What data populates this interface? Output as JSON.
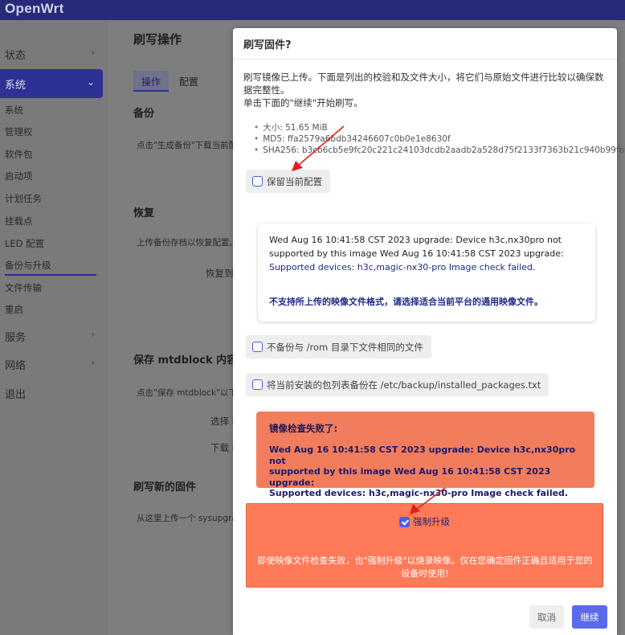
{
  "brand": "OpenWrt",
  "colors": {
    "topbar": "#262a78",
    "accent": "#2d3194",
    "danger_card": "#f27d5c",
    "force_card": "#ff7a59",
    "primary_button": "#5a6ae8",
    "annotation_arrow": "#e02020"
  },
  "sidebar": {
    "items": [
      {
        "label": "状态",
        "icon": "chevron-right-icon"
      },
      {
        "label": "系统",
        "icon": "chevron-down-icon",
        "active": true
      },
      {
        "label": "服务",
        "icon": "chevron-right-icon"
      },
      {
        "label": "网络",
        "icon": "chevron-right-icon"
      },
      {
        "label": "退出"
      }
    ],
    "submenu": [
      "系统",
      "管理权",
      "软件包",
      "启动项",
      "计划任务",
      "挂载点",
      "LED 配置",
      "备份与升级",
      "文件传输",
      "重启"
    ]
  },
  "background": {
    "title": "刷写操作",
    "tabs": [
      "操作",
      "配置"
    ],
    "sections": {
      "backup": "备份",
      "backup_text": "点击\"生成备份\"下载当前配",
      "restore": "恢复",
      "restore_text": "上传备份存档以恢复配置。",
      "restore_to": "恢复到",
      "mtd": "保存 mtdblock 内容",
      "mtd_text": "点击\"保存 mtdblock\"以下",
      "select": "选择 r",
      "download": "下载 r",
      "flash": "刷写新的固件",
      "flash_text": "从这里上传一个 sysupgra"
    }
  },
  "modal": {
    "title": "刷写固件?",
    "intro_line1": "刷写镜像已上传。下面是列出的校验和及文件大小，将它们与原始文件进行比较以确保数据完整性。",
    "intro_line2": "单击下面的\"继续\"开始刷写。",
    "info": {
      "size": "大小: 51.65 MiB",
      "md5": "MD5: ffa2579a6bdb34246607c0b0e1e8630f",
      "sha256": "SHA256: b3cb6cb5e9fc20c221c24103dcdb2aadb2a528d75f2133f7363b21c940b99fbf"
    },
    "keep_config": {
      "label": "保留当前配置",
      "checked": false
    },
    "log": {
      "line1": "Wed Aug 16 10:41:58 CST 2023 upgrade: Device h3c,nx30pro not",
      "line2": "supported by this image Wed Aug 16 10:41:58 CST 2023 upgrade:",
      "line3": "Supported devices: h3c,magic-nx30-pro Image check failed.",
      "error": "不支持所上传的映像文件格式，请选择适合当前平台的通用映像文件。"
    },
    "skip_rom_backup": {
      "label": "不备份与 /rom 目录下文件相同的文件",
      "checked": false
    },
    "backup_packages": {
      "label": "将当前安装的包列表备份在 /etc/backup/installed_packages.txt",
      "checked": false
    },
    "check_failed": {
      "title": "镜像检查失败了:",
      "line1": "Wed Aug 16 10:41:58 CST 2023 upgrade: Device h3c,nx30pro not",
      "line2": "supported by this image Wed Aug 16 10:41:58 CST 2023 upgrade:",
      "line3": "Supported devices: h3c,magic-nx30-pro Image check failed."
    },
    "force": {
      "label": "强制升级",
      "checked": true,
      "note": "即使映像文件检查失败，也\"强制升级\"以烧录映像。仅在您确定固件正确且适用于您的设备时使用!"
    },
    "buttons": {
      "cancel": "取消",
      "continue": "继续"
    }
  }
}
